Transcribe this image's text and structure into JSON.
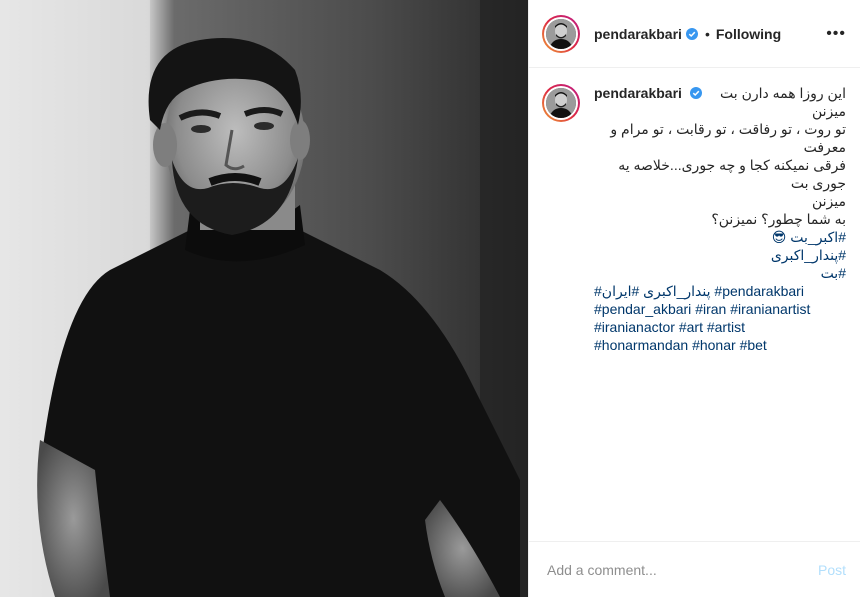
{
  "post": {
    "username": "pendarakbari",
    "separator": "•",
    "follow_status": "Following",
    "more_icon": "more-horizontal-icon"
  },
  "caption": {
    "username": "pendarakbari",
    "lines": [
      "این روزا همه دارن بت میزنن",
      "تو روت ، تو رفاقت ، تو رقابت ، تو مرام و معرفت",
      "فرقی نمیکنه کجا و چه جوری...خلاصه یه جوری بت",
      "میزنن",
      "به شما چطور؟ نمیزنن؟",
      "#اکبر_بت 😎",
      "#پندار_اکبری",
      "#بت"
    ],
    "hashtag_lines": [
      [
        "#پندار_اکبری",
        "#ایران",
        "#pendarakbari"
      ],
      [
        "#pendar_akbari",
        "#iran",
        "#iranianartist"
      ],
      [
        "#iranianactor",
        "#art",
        "#artist"
      ],
      [
        "#honarmandan",
        "#honar",
        "#bet"
      ]
    ]
  },
  "comment_box": {
    "placeholder": "Add a comment...",
    "post_label": "Post"
  },
  "colors": {
    "link": "#00376b",
    "post_disabled": "#b2dffc",
    "verified": "#3897f0"
  }
}
